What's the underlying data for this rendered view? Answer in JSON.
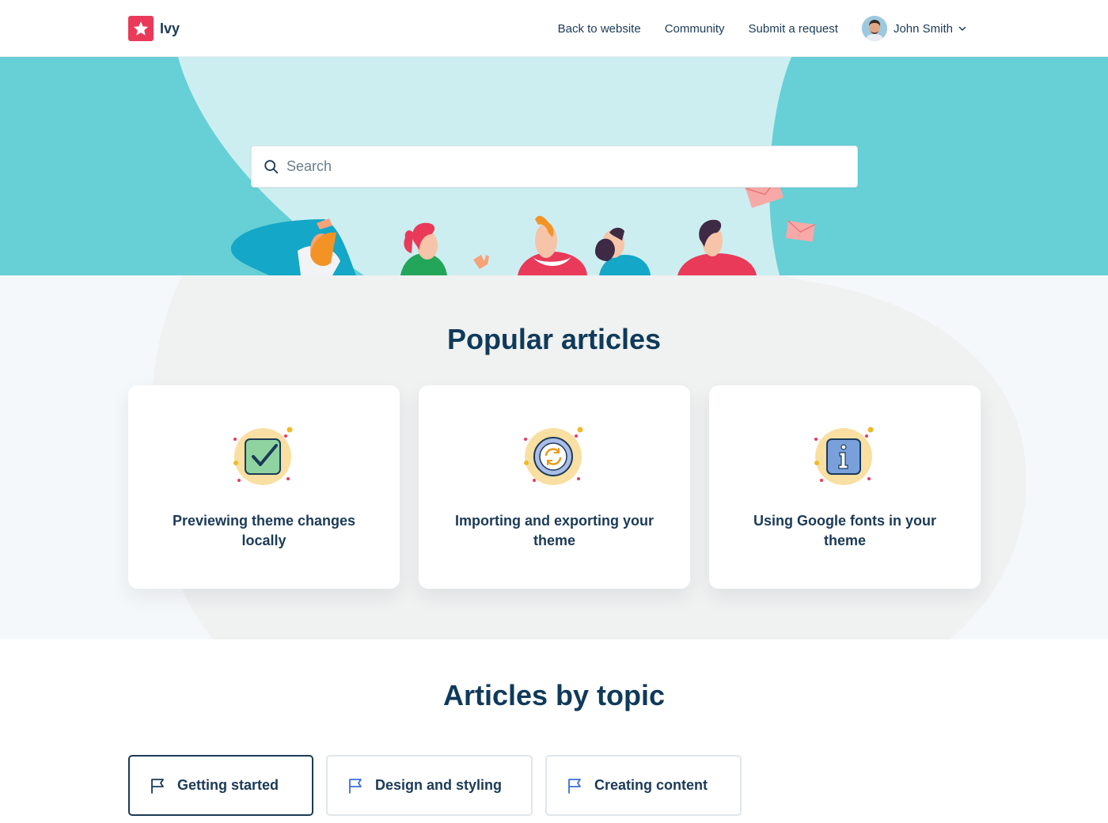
{
  "brand": {
    "name": "Ivy",
    "color": "#e93a5a"
  },
  "nav": {
    "links": [
      "Back to website",
      "Community",
      "Submit a request"
    ],
    "user_name": "John Smith"
  },
  "search": {
    "placeholder": "Search",
    "value": ""
  },
  "popular": {
    "title": "Popular articles",
    "articles": [
      {
        "title": "Previewing theme changes locally",
        "icon": "checkbox-icon"
      },
      {
        "title": "Importing and exporting your theme",
        "icon": "sync-icon"
      },
      {
        "title": "Using Google fonts in your theme",
        "icon": "info-icon"
      }
    ]
  },
  "topics": {
    "title": "Articles by topic",
    "items": [
      {
        "label": "Getting started",
        "icon": "flag-icon",
        "selected": true
      },
      {
        "label": "Design and styling",
        "icon": "flag-icon",
        "selected": false
      },
      {
        "label": "Creating content",
        "icon": "flag-icon",
        "selected": false
      }
    ]
  },
  "colors": {
    "hero_teal": "#66d0d6",
    "hero_light": "#cdeef0",
    "heading": "#0f3a5a",
    "text": "#1b3a57"
  }
}
